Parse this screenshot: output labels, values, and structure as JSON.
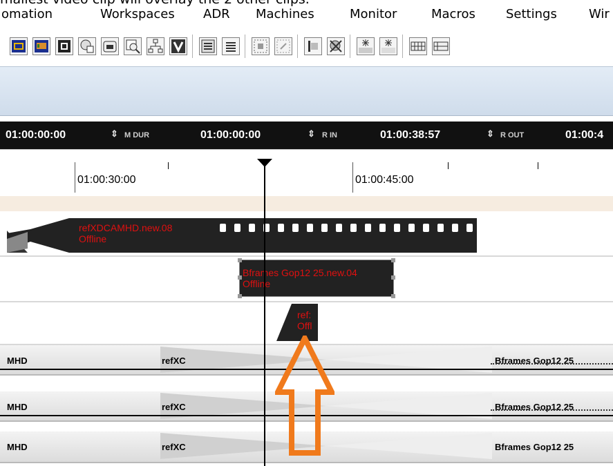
{
  "caption": "mallest video clip will overlay the 2 other clips.",
  "menu": [
    "omation",
    "Workspaces",
    "ADR",
    "Machines",
    "Monitor",
    "Macros",
    "Settings",
    "Wir"
  ],
  "toolbar_icons": [
    "tc-display-icon",
    "waveform-icon",
    "film-icon",
    "record-audio-icon",
    "disk-icon",
    "find-icon",
    "network-icon",
    "video-v-icon",
    "list-icon",
    "align-icon",
    "frame-select-icon",
    "frame-select-grey-icon",
    "marker-icon",
    "settings-icon",
    "spark-icon",
    "spark2-icon",
    "grid-icon",
    "grid2-icon"
  ],
  "timecode": {
    "in": "01:00:00:00",
    "mdur_label": "M DUR",
    "mdur": "01:00:00:00",
    "rin_label": "R IN",
    "rin": "01:00:38:57",
    "rout_label": "R OUT",
    "rout": "01:00:4"
  },
  "ruler": {
    "label1": "01:00:30:00",
    "label2": "01:00:45:00"
  },
  "video": {
    "clip1_name": "refXDCAMHD.new.08",
    "clip1_status": "Offline",
    "clip2_name": "Bframes Gop12 25.new.04",
    "clip2_status": "Offline",
    "clip3_name": "ref:",
    "clip3_status": "Offl"
  },
  "audio": [
    {
      "left": "MHD",
      "mid": "refXC",
      "right": "Bframes Gop12 25"
    },
    {
      "left": "MHD",
      "mid": "refXC",
      "right": "Bframes Gop12 25"
    },
    {
      "left": "MHD",
      "mid": "refXC",
      "right": "Bframes Gop12 25"
    }
  ],
  "colors": {
    "offline_text": "#e01010",
    "clip_body": "#222222",
    "arrow": "#f07a1c"
  }
}
